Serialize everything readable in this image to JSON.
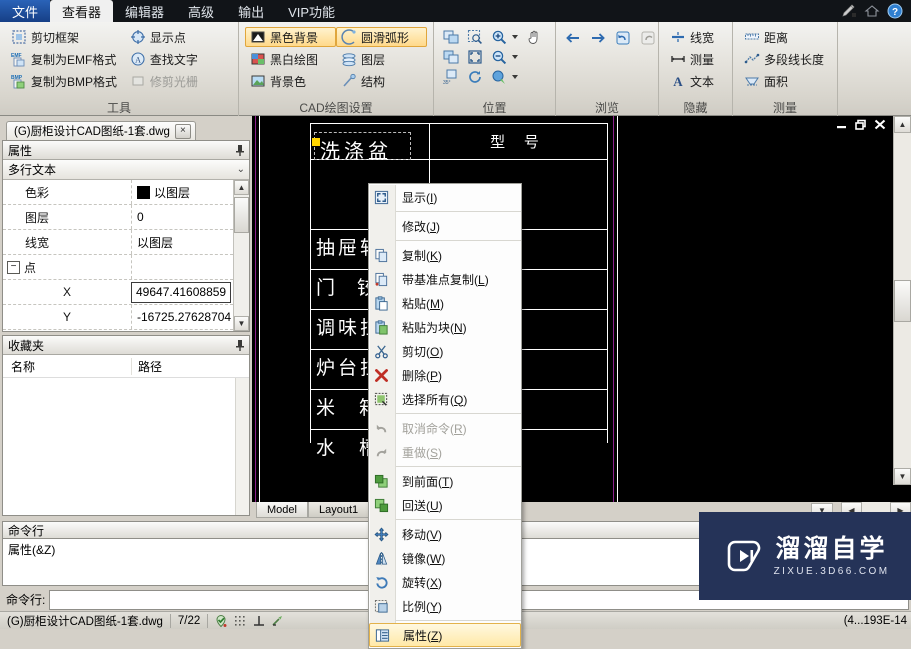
{
  "menubar": {
    "tabs": [
      {
        "label": "文件",
        "state": "file"
      },
      {
        "label": "查看器",
        "state": "active"
      },
      {
        "label": "编辑器",
        "state": "normal"
      },
      {
        "label": "高级",
        "state": "normal"
      },
      {
        "label": "输出",
        "state": "normal"
      },
      {
        "label": "VIP功能",
        "state": "normal"
      }
    ],
    "right_icons": [
      "pencil-edit-icon",
      "home-icon",
      "help-icon"
    ]
  },
  "ribbon": {
    "groups": [
      {
        "title": "工具",
        "col1": [
          {
            "label": "剪切框架",
            "icon": "crop-frame-icon",
            "state": "normal"
          },
          {
            "label": "复制为EMF格式",
            "icon": "copy-emf-icon",
            "state": "normal"
          },
          {
            "label": "复制为BMP格式",
            "icon": "copy-bmp-icon",
            "state": "normal"
          }
        ],
        "col2": [
          {
            "label": "显示点",
            "icon": "show-point-icon",
            "state": "normal"
          },
          {
            "label": "查找文字",
            "icon": "find-text-icon",
            "state": "normal"
          },
          {
            "label": "修剪光栅",
            "icon": "trim-raster-icon",
            "state": "disabled"
          }
        ]
      },
      {
        "title": "CAD绘图设置",
        "col1": [
          {
            "label": "黑色背景",
            "icon": "black-background-icon",
            "state": "selected"
          },
          {
            "label": "黑白绘图",
            "icon": "bw-drawing-icon",
            "state": "normal"
          },
          {
            "label": "背景色",
            "icon": "background-color-icon",
            "state": "normal"
          }
        ],
        "col2": [
          {
            "label": "圆滑弧形",
            "icon": "smooth-arc-icon",
            "state": "selected"
          },
          {
            "label": "图层",
            "icon": "layers-icon",
            "state": "normal"
          },
          {
            "label": "结构",
            "icon": "structure-icon",
            "state": "normal"
          }
        ]
      },
      {
        "title": "位置",
        "icons_row1": [
          "zoom-window-icon",
          "zoom-select-icon",
          "zoom-in-icon",
          "pan-hand-icon"
        ],
        "icons_row2": [
          "zoom-extents-icon",
          "zoom-fit-icon",
          "zoom-out-icon"
        ],
        "icons_row3": [
          "rotate-35-icon",
          "refresh-icon",
          "zoom-realtime-icon"
        ]
      },
      {
        "title": "浏览",
        "icons_row1": [
          "back-arrow-icon",
          "forward-arrow-icon",
          "undo-view-icon",
          "redo-view-icon"
        ]
      },
      {
        "title": "隐藏",
        "col1": [
          {
            "label": "线宽",
            "icon": "lineweight-icon",
            "state": "normal"
          },
          {
            "label": "测量",
            "icon": "measure-icon",
            "state": "normal"
          },
          {
            "label": "文本",
            "icon": "text-a-icon",
            "state": "normal"
          }
        ]
      },
      {
        "title": "测量",
        "col1": [
          {
            "label": "距离",
            "icon": "distance-icon",
            "state": "normal"
          },
          {
            "label": "多段线长度",
            "icon": "polyline-length-icon",
            "state": "normal"
          },
          {
            "label": "面积",
            "icon": "area-icon",
            "state": "normal"
          }
        ]
      }
    ]
  },
  "document_tab": {
    "label": "(G)厨柜设计CAD图纸-1套.dwg",
    "close": "×"
  },
  "properties_panel": {
    "title": "属性",
    "pin": "⊞",
    "object_type": "多行文本",
    "rows": [
      {
        "key": "色彩",
        "value": "以图层",
        "has_swatch": true
      },
      {
        "key": "图层",
        "value": "0",
        "has_swatch": false
      },
      {
        "key": "线宽",
        "value": "以图层",
        "has_swatch": false
      }
    ],
    "group_label": "点",
    "point_rows": [
      {
        "key": "X",
        "value": "49647.41608859",
        "editing": true
      },
      {
        "key": "Y",
        "value": "-16725.27628704",
        "editing": false
      }
    ]
  },
  "favorites_panel": {
    "title": "收藏夹",
    "pin": "⊞",
    "columns": [
      "名称",
      "路径"
    ],
    "rows": []
  },
  "canvas": {
    "table_rows": [
      "洗涤盆",
      "抽屉轨",
      "门 铰",
      "调味拉",
      "炉台拉",
      "米 箱",
      "水 槽"
    ],
    "header_cell": "型  号",
    "mdi_buttons": [
      "minimize-icon",
      "restore-icon",
      "close-icon"
    ],
    "layout_tabs": [
      {
        "label": "Model",
        "active": true
      },
      {
        "label": "Layout1",
        "active": false
      }
    ]
  },
  "command_area": {
    "title": "命令行",
    "history": "属性(&Z)",
    "prompt_label": "命令行:",
    "input_value": ""
  },
  "statusbar": {
    "filename": "(G)厨柜设计CAD图纸-1套.dwg",
    "page": "7/22",
    "icons": [
      "osnap-icon",
      "grid-icon",
      "ortho-icon",
      "polar-icon"
    ],
    "coordinate": "(4...193E-14"
  },
  "context_menu": {
    "items": [
      {
        "label": "显示",
        "accel": "I",
        "icon": "display-icon",
        "state": "normal",
        "sep_after": true
      },
      {
        "label": "修改",
        "accel": "J",
        "icon": "",
        "state": "normal",
        "sep_after": true
      },
      {
        "label": "复制",
        "accel": "K",
        "icon": "copy-icon",
        "state": "normal",
        "sep_after": false
      },
      {
        "label": "带基准点复制",
        "accel": "L",
        "icon": "copy-basepoint-icon",
        "state": "normal",
        "sep_after": false
      },
      {
        "label": "粘贴",
        "accel": "M",
        "icon": "paste-icon",
        "state": "normal",
        "sep_after": false
      },
      {
        "label": "粘贴为块",
        "accel": "N",
        "icon": "paste-block-icon",
        "state": "normal",
        "sep_after": false
      },
      {
        "label": "剪切",
        "accel": "O",
        "icon": "cut-scissors-icon",
        "state": "normal",
        "sep_after": false
      },
      {
        "label": "删除",
        "accel": "P",
        "icon": "delete-x-icon",
        "state": "normal",
        "sep_after": false
      },
      {
        "label": "选择所有",
        "accel": "Q",
        "icon": "select-all-icon",
        "state": "normal",
        "sep_after": true
      },
      {
        "label": "取消命令",
        "accel": "R",
        "icon": "undo-icon",
        "state": "disabled",
        "sep_after": false
      },
      {
        "label": "重做",
        "accel": "S",
        "icon": "redo-icon",
        "state": "disabled",
        "sep_after": true
      },
      {
        "label": "到前面",
        "accel": "T",
        "icon": "bring-front-icon",
        "state": "normal",
        "sep_after": false
      },
      {
        "label": "回送",
        "accel": "U",
        "icon": "send-back-icon",
        "state": "normal",
        "sep_after": true
      },
      {
        "label": "移动",
        "accel": "V",
        "icon": "move-icon",
        "state": "normal",
        "sep_after": false
      },
      {
        "label": "镜像",
        "accel": "W",
        "icon": "mirror-icon",
        "state": "normal",
        "sep_after": false
      },
      {
        "label": "旋转",
        "accel": "X",
        "icon": "rotate-icon",
        "state": "normal",
        "sep_after": false
      },
      {
        "label": "比例",
        "accel": "Y",
        "icon": "scale-icon",
        "state": "normal",
        "sep_after": true
      },
      {
        "label": "属性",
        "accel": "Z",
        "icon": "properties-icon",
        "state": "highlighted",
        "sep_after": false
      }
    ]
  },
  "watermark": {
    "cn": "溜溜自学",
    "en": "ZIXUE.3D66.COM",
    "bg": "#253358"
  },
  "colors": {
    "accent_blue": "#1d4f9e",
    "ribbon_selected": "#ffd98a",
    "canvas_bg": "#000000",
    "grip_yellow": "#ffd400",
    "magenta_line": "#8d1f8d"
  }
}
